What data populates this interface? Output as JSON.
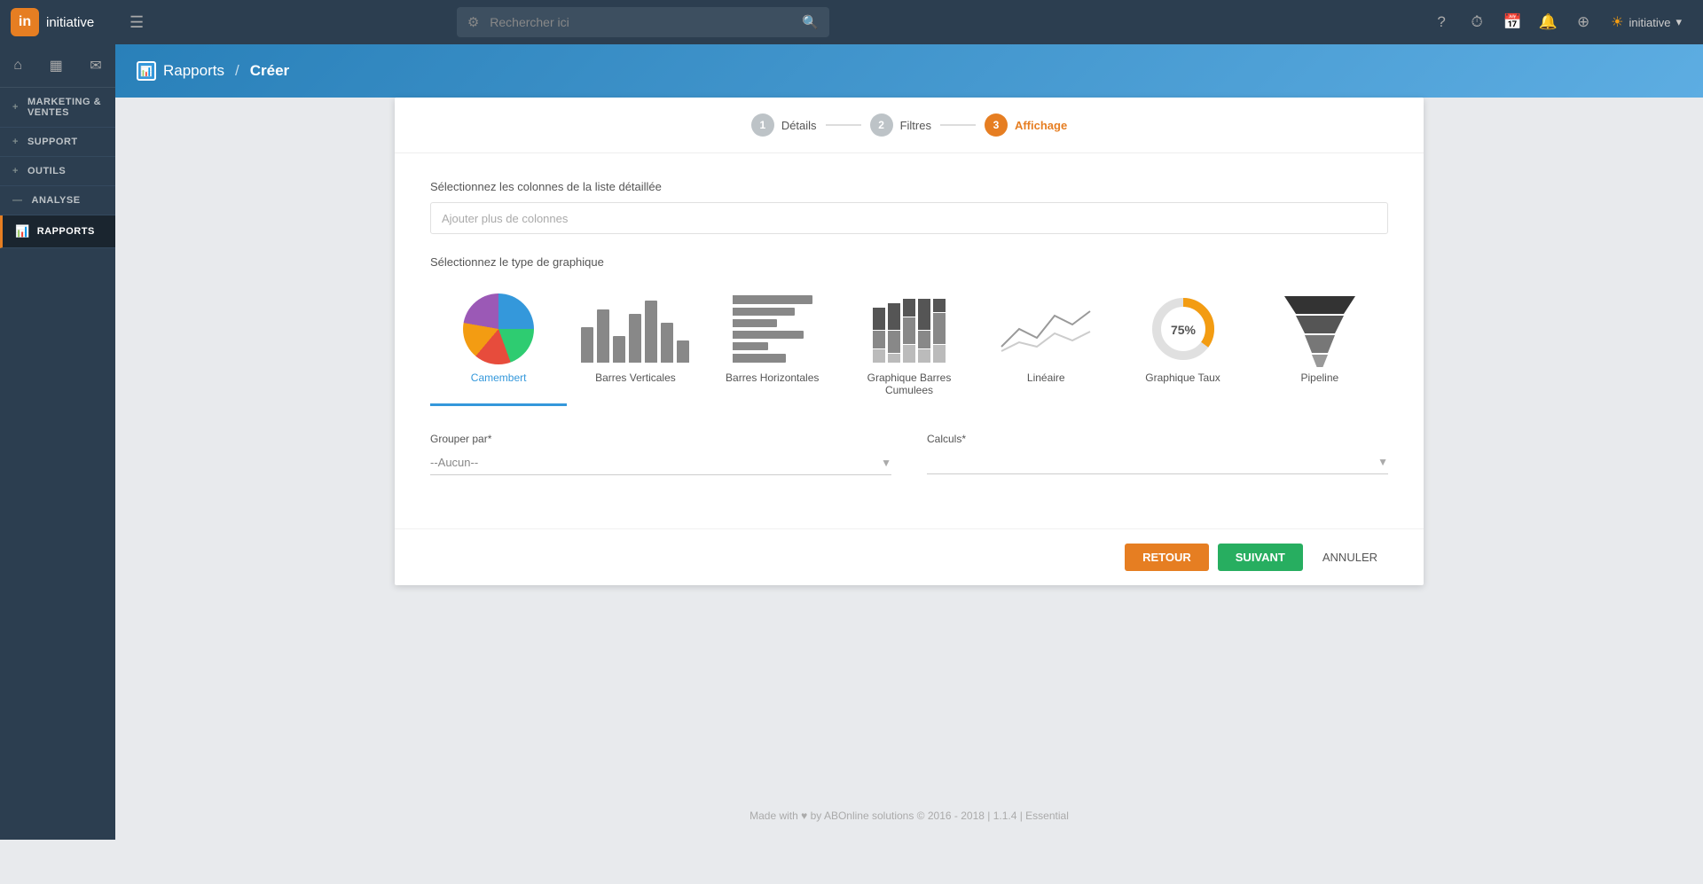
{
  "app": {
    "name": "initiative",
    "logo_letter": "in"
  },
  "topnav": {
    "menu_label": "☰",
    "search_placeholder": "Rechercher ici",
    "icons": {
      "help": "?",
      "history": "⏱",
      "calendar": "📅",
      "bell": "🔔",
      "add": "⊕"
    },
    "user": "initiative",
    "user_icon": "☀"
  },
  "sidebar": {
    "icons": {
      "home": "⌂",
      "calendar": "▦",
      "mail": "✉"
    },
    "items": [
      {
        "id": "marketing",
        "label": "MARKETING & VENTES",
        "prefix": "+"
      },
      {
        "id": "support",
        "label": "SUPPORT",
        "prefix": "+"
      },
      {
        "id": "outils",
        "label": "OUTILS",
        "prefix": "+"
      },
      {
        "id": "analyse",
        "label": "ANALYSE",
        "prefix": "—"
      },
      {
        "id": "rapports",
        "label": "Rapports",
        "active": true
      }
    ]
  },
  "breadcrumb": {
    "section": "Rapports",
    "separator": "/",
    "page": "Créer",
    "icon": "📊"
  },
  "steps": [
    {
      "number": "1",
      "label": "Détails",
      "state": "done"
    },
    {
      "number": "2",
      "label": "Filtres",
      "state": "done"
    },
    {
      "number": "3",
      "label": "Affichage",
      "state": "active"
    }
  ],
  "form": {
    "columns_label": "Sélectionnez les colonnes de la liste détaillée",
    "columns_placeholder": "Ajouter plus de colonnes",
    "chart_type_label": "Sélectionnez le type de graphique",
    "chart_types": [
      {
        "id": "camembert",
        "label": "Camembert",
        "selected": true
      },
      {
        "id": "barres-verticales",
        "label": "Barres Verticales",
        "selected": false
      },
      {
        "id": "barres-horizontales",
        "label": "Barres Horizontales",
        "selected": false
      },
      {
        "id": "graphique-barres-cumulees",
        "label": "Graphique Barres Cumulees",
        "selected": false
      },
      {
        "id": "lineaire",
        "label": "Linéaire",
        "selected": false
      },
      {
        "id": "graphique-taux",
        "label": "Graphique Taux",
        "selected": false
      },
      {
        "id": "pipeline",
        "label": "Pipeline",
        "selected": false
      }
    ],
    "grouper_label": "Grouper par*",
    "grouper_value": "--Aucun--",
    "calculs_label": "Calculs*",
    "calculs_value": ""
  },
  "buttons": {
    "back": "RETOUR",
    "next": "SUIVANT",
    "cancel": "ANNULER"
  },
  "footer": {
    "text": "Made with ♥ by ABOnline solutions © 2016 - 2018 | 1.1.4 | Essential"
  }
}
